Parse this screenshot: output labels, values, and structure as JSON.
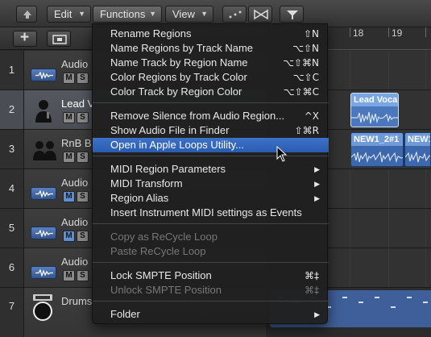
{
  "toolbar": {
    "edit_label": "Edit",
    "functions_label": "Functions",
    "view_label": "View",
    "caret": "▼"
  },
  "ruler": {
    "labels": [
      "18",
      "19"
    ]
  },
  "tracks": [
    {
      "number": "1",
      "name": "Audio",
      "mute": "M",
      "solo": "S",
      "mute_on": false,
      "icon": "audio-waveform-icon"
    },
    {
      "number": "2",
      "name": "Lead V",
      "mute": "M",
      "solo": "S",
      "mute_on": false,
      "icon": "singer-icon",
      "region": "Lead Voca"
    },
    {
      "number": "3",
      "name": "RnB B",
      "mute": "M",
      "solo": "S",
      "mute_on": false,
      "icon": "backing-singers-icon",
      "regions": [
        "NEW1_2#1",
        "NEW1"
      ]
    },
    {
      "number": "4",
      "name": "Audio",
      "mute": "M",
      "solo": "S",
      "mute_on": true,
      "icon": "audio-waveform-icon"
    },
    {
      "number": "5",
      "name": "Audio",
      "mute": "M",
      "solo": "S",
      "mute_on": true,
      "icon": "audio-waveform-icon"
    },
    {
      "number": "6",
      "name": "Audio",
      "mute": "M",
      "solo": "S",
      "mute_on": false,
      "icon": "audio-waveform-icon"
    },
    {
      "number": "7",
      "name": "Drums",
      "icon": "drum-machine-icon"
    }
  ],
  "menu": {
    "items": [
      {
        "label": "Rename Regions",
        "shortcut": "⇧N",
        "enabled": true
      },
      {
        "label": "Name Regions by Track Name",
        "shortcut": "⌥⇧N",
        "enabled": true
      },
      {
        "label": "Name Track by Region Name",
        "shortcut": "⌥⇧⌘N",
        "enabled": true
      },
      {
        "label": "Color Regions by Track Color",
        "shortcut": "⌥⇧C",
        "enabled": true
      },
      {
        "label": "Color Track by Region Color",
        "shortcut": "⌥⇧⌘C",
        "enabled": true
      },
      {
        "label": "Remove Silence from Audio Region...",
        "shortcut": "^X",
        "enabled": true
      },
      {
        "label": "Show Audio File in Finder",
        "shortcut": "⇧⌘R",
        "enabled": true
      },
      {
        "label": "Open in Apple Loops Utility...",
        "shortcut": "",
        "enabled": true,
        "highlighted": true
      },
      {
        "label": "MIDI Region Parameters",
        "submenu": true,
        "enabled": true
      },
      {
        "label": "MIDI Transform",
        "submenu": true,
        "enabled": true
      },
      {
        "label": "Region Alias",
        "submenu": true,
        "enabled": true
      },
      {
        "label": "Insert Instrument MIDI settings as Events",
        "enabled": true
      },
      {
        "label": "Copy as ReCycle Loop",
        "enabled": false
      },
      {
        "label": "Paste ReCycle Loop",
        "enabled": false
      },
      {
        "label": "Lock SMPTE Position",
        "shortcut": "⌘‡",
        "enabled": true
      },
      {
        "label": "Unlock SMPTE Position",
        "shortcut": "⌘‡",
        "enabled": false
      },
      {
        "label": "Folder",
        "submenu": true,
        "enabled": true
      }
    ],
    "submenu_arrow": "▶"
  },
  "colors": {
    "highlight": "#2f63b9",
    "region": "#4a77bd",
    "mute_on": "#5b8fd6"
  }
}
